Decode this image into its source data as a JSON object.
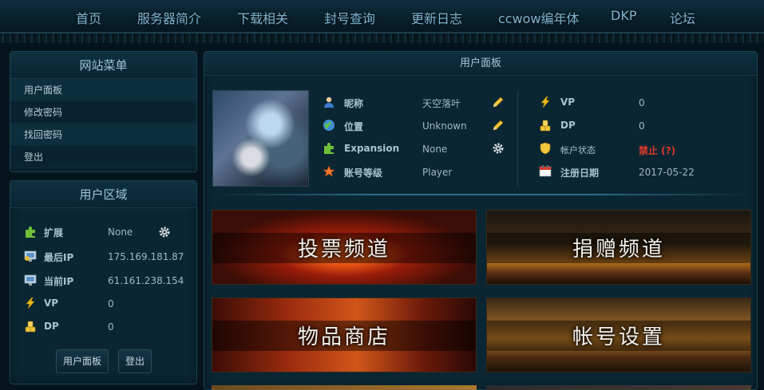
{
  "nav": {
    "items": [
      "首页",
      "服务器简介",
      "下载相关",
      "封号查询",
      "更新日志",
      "ccwow编年体",
      "DKP",
      "论坛"
    ]
  },
  "site_menu": {
    "title": "网站菜单",
    "items": [
      "用户面板",
      "修改密码",
      "找回密码",
      "登出"
    ]
  },
  "user_area": {
    "title": "用户区域",
    "rows": [
      {
        "label": "扩展",
        "value": "None",
        "icon": "puzzle-icon"
      },
      {
        "label": "最后IP",
        "value": "175.169.181.87",
        "icon": "monitor-icon"
      },
      {
        "label": "当前IP",
        "value": "61.161.238.154",
        "icon": "monitor-icon"
      },
      {
        "label": "VP",
        "value": "0",
        "icon": "lightning-icon"
      },
      {
        "label": "DP",
        "value": "0",
        "icon": "coins-icon"
      }
    ],
    "buttons": [
      "用户面板",
      "登出"
    ]
  },
  "user_panel": {
    "title": "用户面板",
    "left_rows": [
      {
        "label": "昵称",
        "value": "天空落叶",
        "icon": "user-icon",
        "action": "edit-pencil-icon"
      },
      {
        "label": "位置",
        "value": "Unknown",
        "icon": "globe-icon",
        "action": "edit-pencil-icon"
      },
      {
        "label": "Expansion",
        "value": "None",
        "icon": "puzzle-icon",
        "action": "gear-icon"
      },
      {
        "label": "账号等级",
        "value": "Player",
        "icon": "rank-star-icon"
      }
    ],
    "right_rows": [
      {
        "label": "VP",
        "value": "0",
        "icon": "lightning-icon"
      },
      {
        "label": "DP",
        "value": "0",
        "icon": "coins-icon"
      },
      {
        "label": "帐户状态",
        "value": "禁止 (?)",
        "icon": "shield-icon"
      },
      {
        "label": "注册日期",
        "value": "2017-05-22",
        "icon": "calendar-icon"
      }
    ],
    "status_color": "#e23a2a"
  },
  "banners": [
    "投票频道",
    "捐赠频道",
    "物品商店",
    "帐号设置"
  ]
}
